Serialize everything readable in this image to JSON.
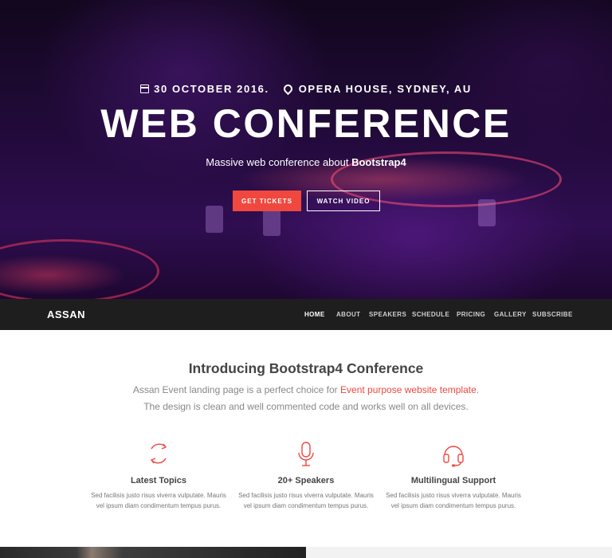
{
  "colors": {
    "accent": "#f0483e",
    "nav_bg": "#1e1e1e",
    "hero_tint": "#3b1163"
  },
  "hero": {
    "date": "30 OCTOBER 2016.",
    "location": "OPERA HOUSE, SYDNEY, AU",
    "title": "WEB CONFERENCE",
    "subtitle_prefix": "Massive web conference about ",
    "subtitle_bold": "Bootstrap4",
    "primary_button": "GET TICKETS",
    "secondary_button": "WATCH VIDEO",
    "icons": {
      "date": "calendar-icon",
      "location": "map-marker-icon"
    }
  },
  "nav": {
    "brand": "ASSAN",
    "items": [
      {
        "label": "HOME",
        "active": true
      },
      {
        "label": "ABOUT"
      },
      {
        "label": "SPEAKERS"
      },
      {
        "label": "SCHEDULE"
      },
      {
        "label": "PRICING"
      },
      {
        "label": "GALLERY"
      },
      {
        "label": "SUBSCRIBE"
      }
    ]
  },
  "intro": {
    "title": "Introducing Bootstrap4 Conference",
    "line1_prefix": "Assan Event landing page is a perfect choice for ",
    "line1_link": "Event purpose website template",
    "line1_suffix": ".",
    "line2": "The design is clean and well commented code and works well on all devices."
  },
  "features": [
    {
      "icon": "refresh-icon",
      "title": "Latest Topics",
      "line1": "Sed facilisis justo risus viverra vulputate. Mauris",
      "line2": "vel ipsum diam condimentum tempus purus."
    },
    {
      "icon": "microphone-icon",
      "title": "20+ Speakers",
      "line1": "Sed facilisis justo risus viverra vulputate. Mauris",
      "line2": "vel ipsum diam condimentum tempus purus."
    },
    {
      "icon": "headset-icon",
      "title": "Multilingual Support",
      "line1": "Sed facilisis justo risus viverra vulputate. Mauris",
      "line2": "vel ipsum diam condimentum tempus purus."
    }
  ]
}
